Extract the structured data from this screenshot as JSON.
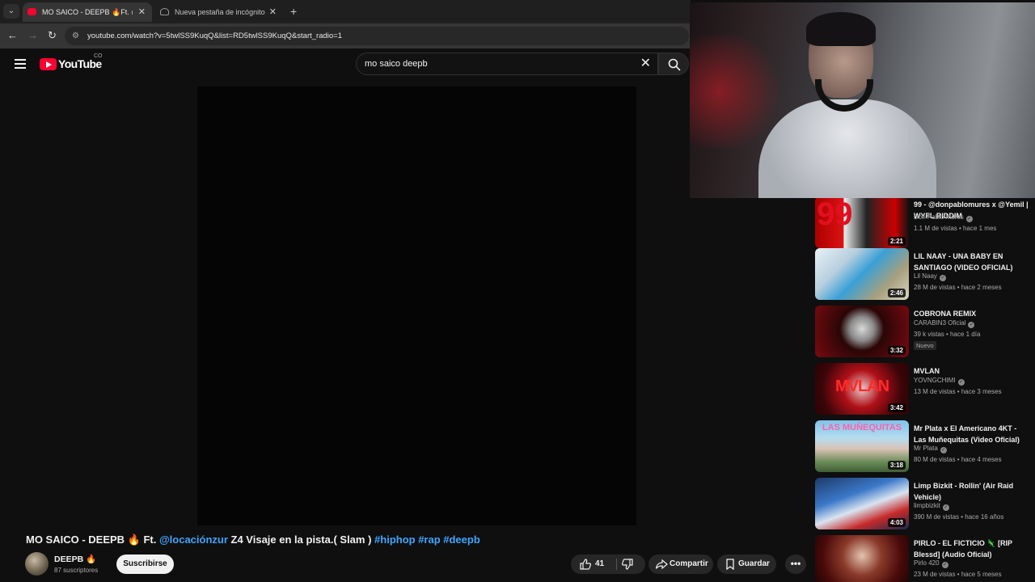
{
  "browser": {
    "tabs": [
      {
        "title": "MO SAICO - DEEPB 🔥Ft. @loc",
        "active": true
      },
      {
        "title": "Nueva pestaña de incógnito",
        "active": false
      }
    ],
    "url": "youtube.com/watch?v=5twlSS9KuqQ&list=RD5twlSS9KuqQ&start_radio=1"
  },
  "header": {
    "logo_text": "YouTube",
    "region": "CO",
    "search_query": "mo saico deepb"
  },
  "video": {
    "title_prefix": "MO SAICO - DEEPB 🔥 Ft. ",
    "mention": "@locaciónzur",
    "title_middle": " Z4 Visaje en la pista.( Slam ) ",
    "hashtags": "#hiphop #rap #deepb",
    "channel_name": "DEEPB 🔥",
    "subscribers": "87 suscriptores",
    "subscribe_label": "Suscribirse",
    "likes": "41",
    "share_label": "Compartir",
    "save_label": "Guardar",
    "more_label": "•••"
  },
  "related": [
    {
      "title": "99 - @donpablomures x @Yemil | WYFL RIDDIM",
      "channel": "Don Pablo Mures",
      "meta": "1.1 M de vistas • hace 1 mes",
      "duration": "2:21",
      "verified": true,
      "thumb_text": "99"
    },
    {
      "title": "LIL NAAY - UNA BABY EN SANTIAGO (VIDEO OFICIAL)",
      "channel": "Lil Naay",
      "meta": "28 M de vistas • hace 2 meses",
      "duration": "2:46",
      "verified": true,
      "thumb_text": ""
    },
    {
      "title": "COBRONA REMIX",
      "channel": "CARABIN3 Oficial",
      "meta": "39 k vistas • hace 1 día",
      "duration": "3:32",
      "verified": true,
      "badge": "Nuevo",
      "thumb_text": ""
    },
    {
      "title": "MVLAN",
      "channel": "YOVNGCHIMI",
      "meta": "13 M de vistas • hace 3 meses",
      "duration": "3:42",
      "verified": true,
      "thumb_text": "MVLAN"
    },
    {
      "title": "Mr Plata x El Americano 4KT - Las Muñequitas (Video Oficial)",
      "channel": "Mr Plata",
      "meta": "80 M de vistas • hace 4 meses",
      "duration": "3:18",
      "verified": true,
      "thumb_text": "LAS MUÑEQUITAS"
    },
    {
      "title": "Limp Bizkit - Rollin' (Air Raid Vehicle)",
      "channel": "limpbizkit",
      "meta": "390 M de vistas • hace 16 años",
      "duration": "4:03",
      "verified": true,
      "thumb_text": ""
    },
    {
      "title": "PIRLO - EL FICTICIO 🦎 [RIP Blessd] (Audio Oficial)",
      "channel": "Pirlo 420",
      "meta": "23 M de vistas • hace 5 meses",
      "duration": "",
      "verified": true,
      "thumb_text": ""
    }
  ]
}
